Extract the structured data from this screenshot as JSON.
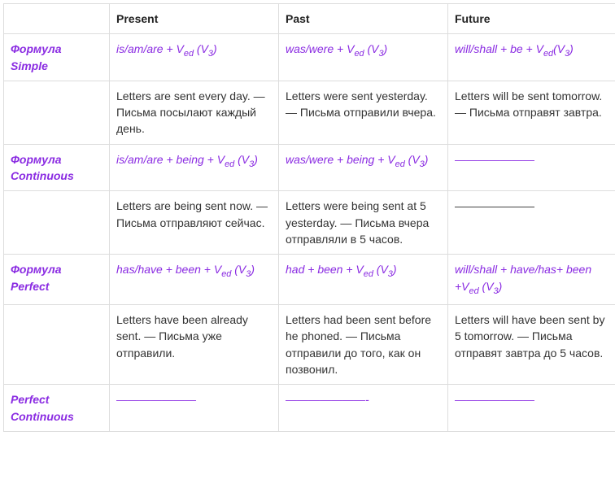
{
  "headers": {
    "blank": "",
    "present": "Present",
    "past": "Past",
    "future": "Future"
  },
  "rows": {
    "simple": {
      "label_line1": "Формула",
      "label_line2": "Simple",
      "formula_present_a": "is/am/are + V",
      "formula_present_b": "ed",
      "formula_present_c": " (V",
      "formula_present_d": "3",
      "formula_present_e": ")",
      "formula_past_a": "was/were + V",
      "formula_past_b": "ed",
      "formula_past_c": " (V",
      "formula_past_d": "3",
      "formula_past_e": ")",
      "formula_future_a": "will/shall + be + V",
      "formula_future_b": "ed",
      "formula_future_c": "(V",
      "formula_future_d": "3",
      "formula_future_e": ")",
      "example_present": " Letters are sent every day. — Письма посылают каждый день.",
      "example_past": " Letters were sent yesterday. — Письма отправили вчера.",
      "example_future": " Letters will be sent tomorrow. — Письма отправят завтра."
    },
    "continuous": {
      "label_line1": "Формула",
      "label_line2": "Continuous",
      "formula_present_a": "is/am/are + being + V",
      "formula_present_b": "ed",
      "formula_present_c": " (V",
      "formula_present_d": "3",
      "formula_present_e": ")",
      "formula_past_a": "was/were + being + V",
      "formula_past_b": "ed",
      "formula_past_c": " (V",
      "formula_past_d": "3",
      "formula_past_e": ")",
      "formula_future": "———————",
      "example_present": " Letters are being sent now. — Письма отправляют сейчас.",
      "example_past": " Letters were being sent at 5 yesterday. — Письма вчера отправляли в 5 часов.",
      "example_future": "———————"
    },
    "perfect": {
      "label_line1": "Формула",
      "label_line2": "Perfect",
      "formula_present_a": "has/have + been + V",
      "formula_present_b": "ed",
      "formula_present_c": " (V",
      "formula_present_d": "3",
      "formula_present_e": ")",
      "formula_past_a": "had + been + V",
      "formula_past_b": "ed",
      "formula_past_c": " (V",
      "formula_past_d": "3",
      "formula_past_e": ")",
      "formula_future_a": " will/shall + have/has+ been +V",
      "formula_future_b": "ed",
      "formula_future_c": " (V",
      "formula_future_d": "3",
      "formula_future_e": ")",
      "example_present": "  Letters have been already sent. — Письма уже отправили.",
      "example_past": " Letters had been sent before he phoned. — Письма отправили до того, как он позвонил.",
      "example_future": "  Letters will have been sent by 5 tomorrow. — Письма отправят завтра до 5 часов."
    },
    "perfect_continuous": {
      "label_line1": "Perfect",
      "label_line2": "Continuous",
      "present": "———————",
      "past": "———————-",
      "future": "———————"
    }
  }
}
